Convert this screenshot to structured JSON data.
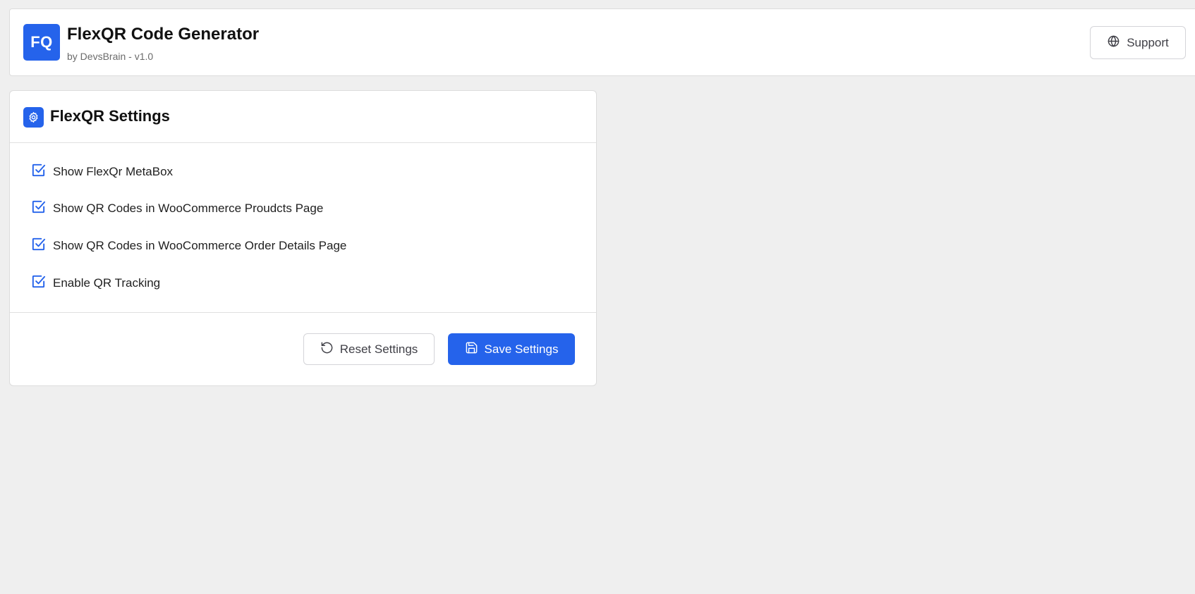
{
  "header": {
    "logo_text": "FQ",
    "title": "FlexQR Code Generator",
    "subtitle": "by DevsBrain - v1.0",
    "support_label": "Support"
  },
  "settings": {
    "title": "FlexQR Settings",
    "options": [
      {
        "label": "Show FlexQr MetaBox",
        "checked": true
      },
      {
        "label": "Show QR Codes in WooCommerce Proudcts Page",
        "checked": true
      },
      {
        "label": "Show QR Codes in WooCommerce Order Details Page",
        "checked": true
      },
      {
        "label": "Enable QR Tracking",
        "checked": true
      }
    ],
    "reset_label": "Reset Settings",
    "save_label": "Save Settings"
  },
  "colors": {
    "accent": "#2563eb",
    "background": "#efefef"
  }
}
